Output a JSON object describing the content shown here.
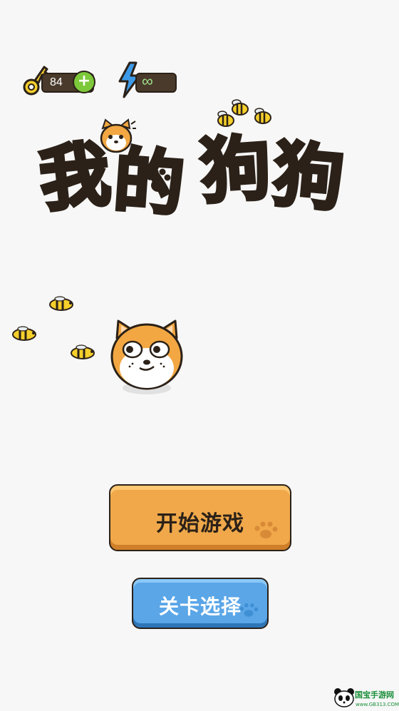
{
  "hud": {
    "keys_count": "84",
    "energy_value": "∞"
  },
  "title": {
    "chars": [
      "我",
      "的",
      "狗",
      "狗"
    ]
  },
  "menu": {
    "start_label": "开始游戏",
    "level_select_label": "关卡选择"
  },
  "watermark": {
    "name": "国宝手游网",
    "url": "www.GB313.COM"
  }
}
